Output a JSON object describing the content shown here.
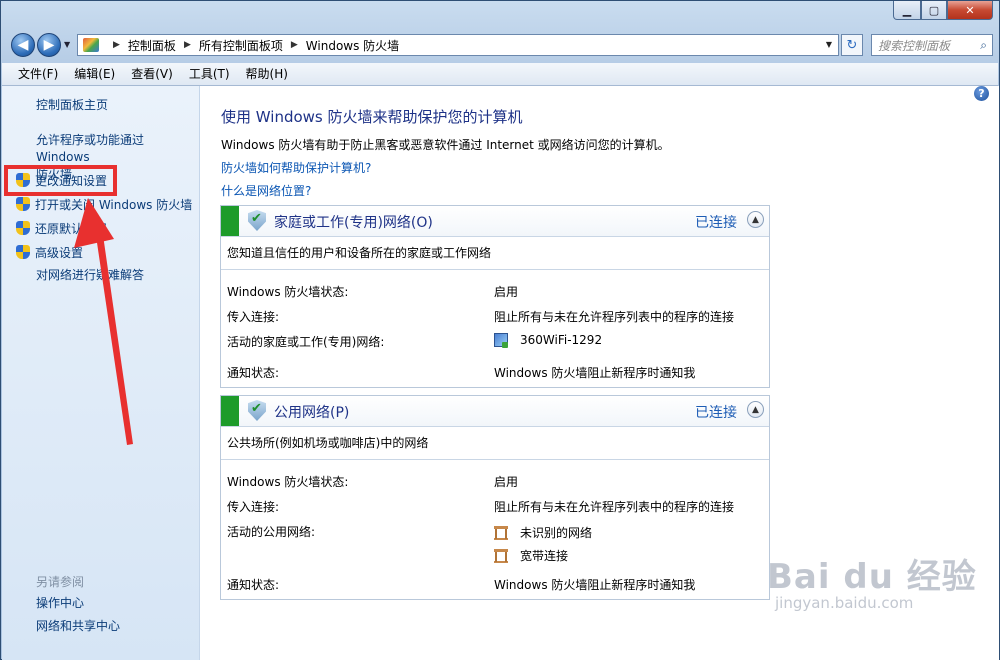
{
  "window": {
    "caption_min": "▁",
    "caption_max": "▢",
    "caption_close": "✕"
  },
  "address_bar": {
    "crumbs": [
      "控制面板",
      "所有控制面板项",
      "Windows 防火墙"
    ],
    "search_placeholder": "搜索控制面板"
  },
  "menu": [
    "文件(F)",
    "编辑(E)",
    "查看(V)",
    "工具(T)",
    "帮助(H)"
  ],
  "sidebar": {
    "home": "控制面板主页",
    "allow_programs_line1": "允许程序或功能通过 Windows",
    "allow_programs_line2": "防火墙",
    "items": [
      {
        "label": "更改通知设置",
        "icon": "uac-shield-icon"
      },
      {
        "label": "打开或关闭 Windows 防火墙",
        "icon": "uac-shield-icon"
      },
      {
        "label": "还原默认设置",
        "icon": "uac-shield-icon"
      },
      {
        "label": "高级设置",
        "icon": "uac-shield-icon"
      }
    ],
    "troubleshoot": "对网络进行疑难解答",
    "see_also_title": "另请参阅",
    "see_also": [
      "操作中心",
      "网络和共享中心"
    ]
  },
  "annotation": {
    "highlight_color": "#e8302f"
  },
  "main": {
    "title": "使用 Windows 防火墙来帮助保护您的计算机",
    "description": "Windows 防火墙有助于防止黑客或恶意软件通过 Internet 或网络访问您的计算机。",
    "link_how": "防火墙如何帮助保护计算机?",
    "link_location": "什么是网络位置?",
    "help_glyph": "?",
    "panels": [
      {
        "title": "家庭或工作(专用)网络(O)",
        "status": "已连接",
        "subtitle": "您知道且信任的用户和设备所在的家庭或工作网络",
        "rows": {
          "state_label": "Windows 防火墙状态:",
          "state_value": "启用",
          "incoming_label": "传入连接:",
          "incoming_value": "阻止所有与未在允许程序列表中的程序的连接",
          "active_label": "活动的家庭或工作(专用)网络:",
          "active_networks": [
            "360WiFi-1292"
          ],
          "notify_label": "通知状态:",
          "notify_value": "Windows 防火墙阻止新程序时通知我"
        }
      },
      {
        "title": "公用网络(P)",
        "status": "已连接",
        "subtitle": "公共场所(例如机场或咖啡店)中的网络",
        "rows": {
          "state_label": "Windows 防火墙状态:",
          "state_value": "启用",
          "incoming_label": "传入连接:",
          "incoming_value": "阻止所有与未在允许程序列表中的程序的连接",
          "active_label": "活动的公用网络:",
          "active_networks": [
            "未识别的网络",
            "宽带连接"
          ],
          "notify_label": "通知状态:",
          "notify_value": "Windows 防火墙阻止新程序时通知我"
        }
      }
    ]
  },
  "watermark": {
    "brand": "Bai du 经验",
    "url": "jingyan.baidu.com"
  }
}
